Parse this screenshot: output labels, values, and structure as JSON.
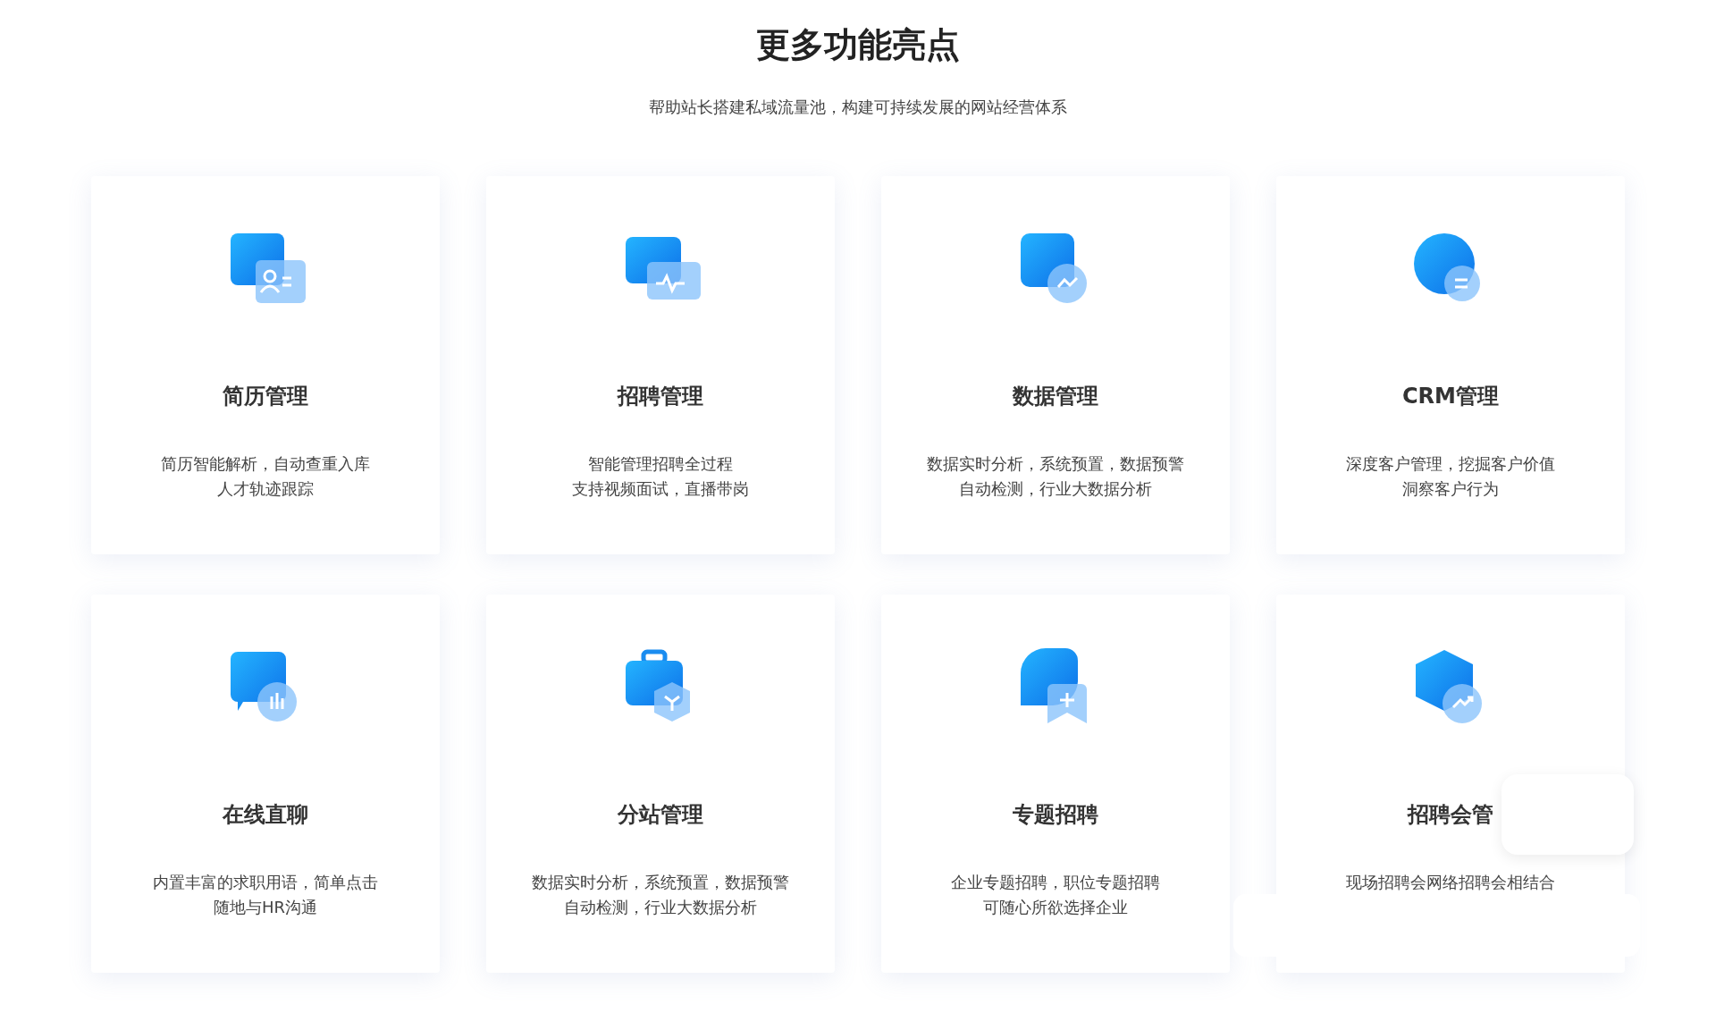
{
  "heading": "更多功能亮点",
  "subheading": "帮助站长搭建私域流量池，构建可持续发展的网站经营体系",
  "cards": [
    {
      "title": "简历管理",
      "lines": [
        "简历智能解析，自动查重入库",
        "人才轨迹跟踪"
      ]
    },
    {
      "title": "招聘管理",
      "lines": [
        "智能管理招聘全过程",
        "支持视频面试，直播带岗"
      ]
    },
    {
      "title": "数据管理",
      "lines": [
        "数据实时分析，系统预置，数据预警",
        "自动检测，行业大数据分析"
      ]
    },
    {
      "title": "CRM管理",
      "lines": [
        "深度客户管理，挖掘客户价值",
        "洞察客户行为"
      ]
    },
    {
      "title": "在线直聊",
      "lines": [
        "内置丰富的求职用语，简单点击",
        "随地与HR沟通"
      ]
    },
    {
      "title": "分站管理",
      "lines": [
        "数据实时分析，系统预置，数据预警",
        "自动检测，行业大数据分析"
      ]
    },
    {
      "title": "专题招聘",
      "lines": [
        "企业专题招聘，职位专题招聘",
        "可随心所欲选择企业"
      ]
    },
    {
      "title": "招聘会管",
      "lines": [
        "现场招聘会网络招聘会相结合"
      ]
    }
  ]
}
